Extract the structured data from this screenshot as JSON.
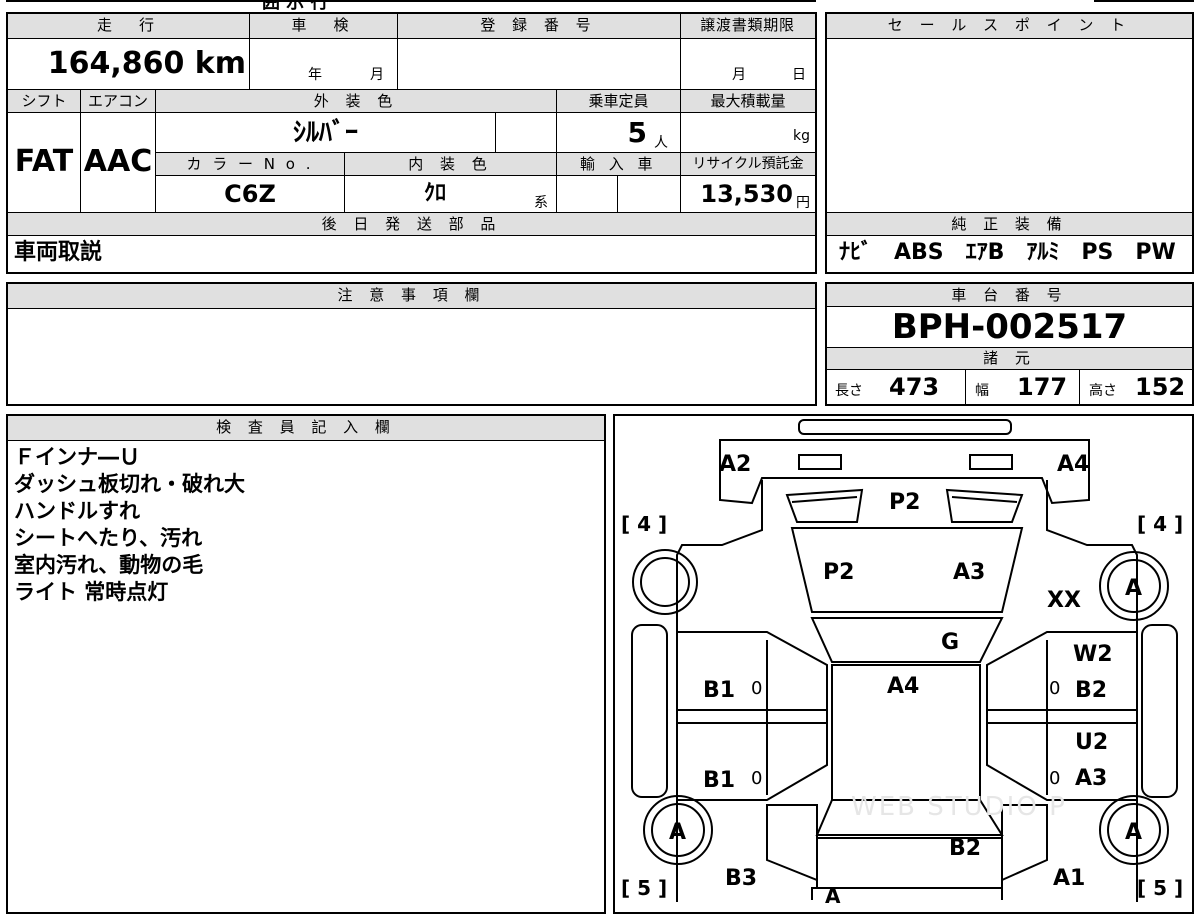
{
  "top_strip": {
    "partial_text": "囲 示 行"
  },
  "spec": {
    "mileage_label": "走　行",
    "mileage_value": "164,860 km",
    "shaken_label": "車　検",
    "shaken_year": "年",
    "shaken_month": "月",
    "reg_label": "登 録 番 号",
    "transfer_label": "譲渡書類期限",
    "transfer_month": "月",
    "transfer_day": "日",
    "shift_label": "シフト",
    "shift_value": "FAT",
    "aircon_label": "エアコン",
    "aircon_value": "AAC",
    "color_label": "外 装 色",
    "color_value": "ｼﾙﾊﾞｰ",
    "seats_label": "乗車定員",
    "seats_value": "5",
    "seats_unit": "人",
    "load_label": "最大積載量",
    "load_unit": "kg",
    "color_no_label": "カ ラ ー N o .",
    "color_no_value": "C6Z",
    "interior_label": "内 装 色",
    "interior_value": "ｸﾛ",
    "interior_unit": "系",
    "import_label": "輸 入 車",
    "recycle_label": "リサイクル預託金",
    "recycle_value": "13,530",
    "recycle_unit": "円",
    "later_label": "後 日 発 送 部 品",
    "later_value": "車両取説"
  },
  "sales": {
    "label": "セ ー ル ス ポ イ ン ト",
    "equip_label": "純 正 装 備",
    "equip_value": "ﾅﾋﾞ　ABS　ｴｱB　ｱﾙﾐ　PS　PW"
  },
  "caution": {
    "label": "注 意 事 項 欄"
  },
  "chassis": {
    "label": "車 台 番 号",
    "value": "BPH-002517",
    "dims_label": "諸 元",
    "length_label": "長さ",
    "length_value": "473",
    "width_label": "幅",
    "width_value": "177",
    "height_label": "高さ",
    "height_value": "152"
  },
  "inspector": {
    "label": "検 査 員 記 入 欄",
    "lines": [
      "Ｆインナ―Ｕ",
      "ダッシュ板切れ・破れ大",
      "ハンドルすれ",
      "シートへたり、汚れ",
      "室内汚れ、動物の毛",
      "ライト 常時点灯"
    ]
  },
  "diagram": {
    "tire_fl": "4",
    "tire_fr": "4",
    "tire_rl": "5",
    "tire_rr": "5",
    "marks": {
      "front_left": "A2",
      "front_right": "A4",
      "bumper": "P2",
      "hood_left": "P2",
      "hood_right": "A3",
      "right_fender": "XX",
      "wheel_fr": "A",
      "windshield": "G",
      "roof": "A4",
      "right_front_door_top": "W2",
      "right_front_door": "B2",
      "right_rear_door_top": "U2",
      "right_rear_door": "A3",
      "left_front_door": "B1",
      "left_rear_door": "B1",
      "zero_lf": "0",
      "zero_lr": "0",
      "zero_rf": "0",
      "zero_rr": "0",
      "wheel_rl": "A",
      "wheel_rr": "A",
      "trunk": "B2",
      "rear_left": "B3",
      "rear_right": "A1",
      "rear_bumper": "A"
    },
    "watermark": "WEB STUDIO P"
  }
}
